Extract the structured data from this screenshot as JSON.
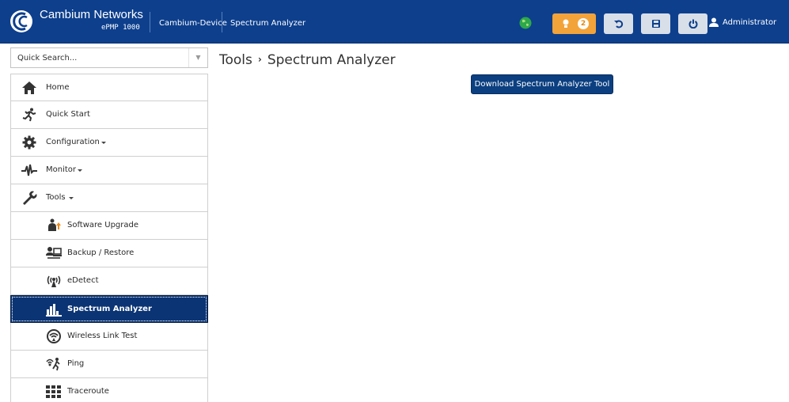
{
  "header": {
    "brand_name": "Cambium Networks",
    "brand_model": "ePMP 1000",
    "device_name": "Cambium-Device",
    "current_page": "Spectrum Analyzer",
    "alert_count": "2",
    "user": "Administrator",
    "accent_color": "#0d3f8d",
    "alert_color": "#f2a33a"
  },
  "search": {
    "placeholder": "Quick Search..."
  },
  "sidebar": {
    "items": [
      {
        "label": "Home",
        "icon": "home-icon"
      },
      {
        "label": "Quick Start",
        "icon": "running-man-icon"
      },
      {
        "label": "Configuration",
        "icon": "gear-icon",
        "dropdown": true
      },
      {
        "label": "Monitor",
        "icon": "pulse-icon",
        "dropdown": true
      },
      {
        "label": "Tools",
        "icon": "wrench-icon",
        "dropdown": true,
        "expanded": true
      },
      {
        "label": "Software Upgrade",
        "icon": "upgrade-icon"
      },
      {
        "label": "Backup / Restore",
        "icon": "backup-icon"
      },
      {
        "label": "eDetect",
        "icon": "antenna-icon"
      },
      {
        "label": "Spectrum Analyzer",
        "icon": "bar-chart-icon",
        "active": true
      },
      {
        "label": "Wireless Link Test",
        "icon": "signal-icon"
      },
      {
        "label": "Ping",
        "icon": "ping-icon"
      },
      {
        "label": "Traceroute",
        "icon": "traceroute-icon"
      }
    ]
  },
  "main": {
    "breadcrumb_parent": "Tools",
    "breadcrumb_separator": "›",
    "breadcrumb_current": "Spectrum Analyzer",
    "download_button": "Download Spectrum Analyzer Tool"
  }
}
